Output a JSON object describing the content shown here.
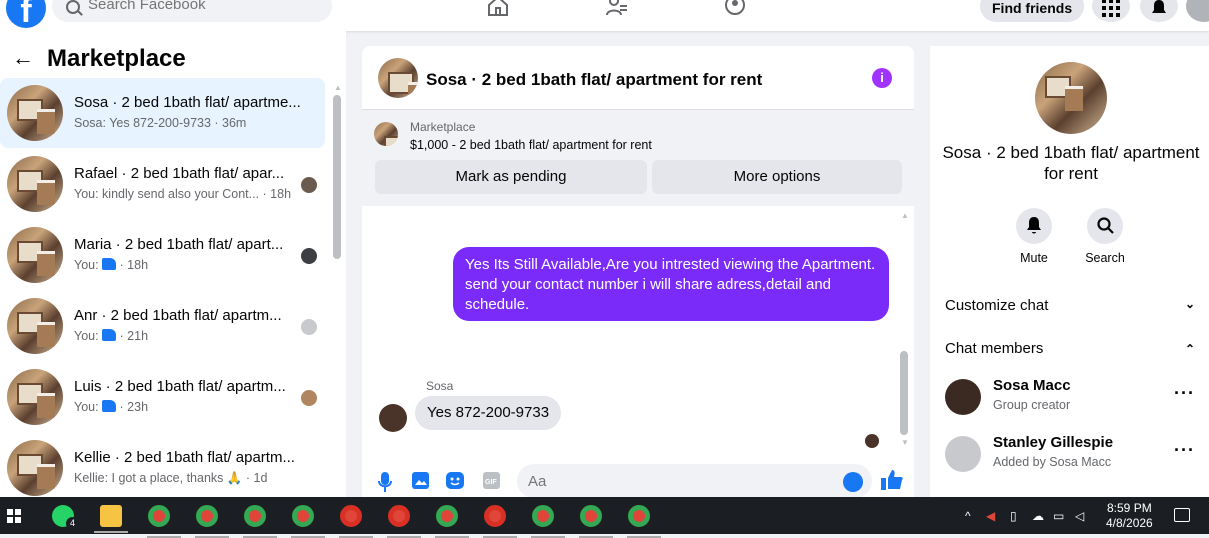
{
  "topbar": {
    "search_placeholder": "Search Facebook",
    "find_friends": "Find friends"
  },
  "sidebar": {
    "title": "Marketplace",
    "conversations": [
      {
        "title": "Sosa · 2 bed 1bath flat/ apartme...",
        "preview": "Sosa: Yes 872-200-9733 · 36m"
      },
      {
        "title": "Rafael · 2 bed 1bath flat/ apar...",
        "preview": "You: kindly send also your Cont... · 18h"
      },
      {
        "title": "Maria · 2 bed 1bath flat/ apart...",
        "preview_prefix": "You:",
        "preview_suffix": "· 18h"
      },
      {
        "title": "Anr · 2 bed 1bath flat/ apartm...",
        "preview_prefix": "You:",
        "preview_suffix": "· 21h"
      },
      {
        "title": "Luis · 2 bed 1bath flat/ apartm...",
        "preview_prefix": "You:",
        "preview_suffix": "· 23h"
      },
      {
        "title": "Kellie · 2 bed 1bath flat/ apartm...",
        "preview": "Kellie: I got a place, thanks 🙏 · 1d"
      }
    ]
  },
  "chat": {
    "title": "Sosa · 2 bed 1bath flat/ apartment for rent",
    "marketplace_label": "Marketplace",
    "listing": "$1,000 - 2 bed 1bath flat/ apartment for rent",
    "mark_pending": "Mark as pending",
    "more_options": "More options",
    "outgoing_message": "Yes Its Still Available,Are you intrested viewing the Apartment. send your contact number i will share adress,detail and schedule.",
    "sender_name": "Sosa",
    "incoming_message": "Yes 872-200-9733",
    "composer_placeholder": "Aa"
  },
  "details": {
    "name": "Sosa · 2 bed 1bath flat/ apartment for rent",
    "mute": "Mute",
    "search": "Search",
    "customize_chat": "Customize chat",
    "chat_members": "Chat members",
    "members": [
      {
        "name": "Sosa Macc",
        "role": "Group creator"
      },
      {
        "name": "Stanley Gillespie",
        "role": "Added by Sosa Macc"
      }
    ]
  },
  "taskbar": {
    "whatsapp_badge": "4",
    "time": "8:59 PM",
    "date": "4/8/2026"
  },
  "colors": {
    "facebook_blue": "#1877f2",
    "outgoing_bubble": "#7b2bf9",
    "active_row": "#e7f3ff"
  }
}
